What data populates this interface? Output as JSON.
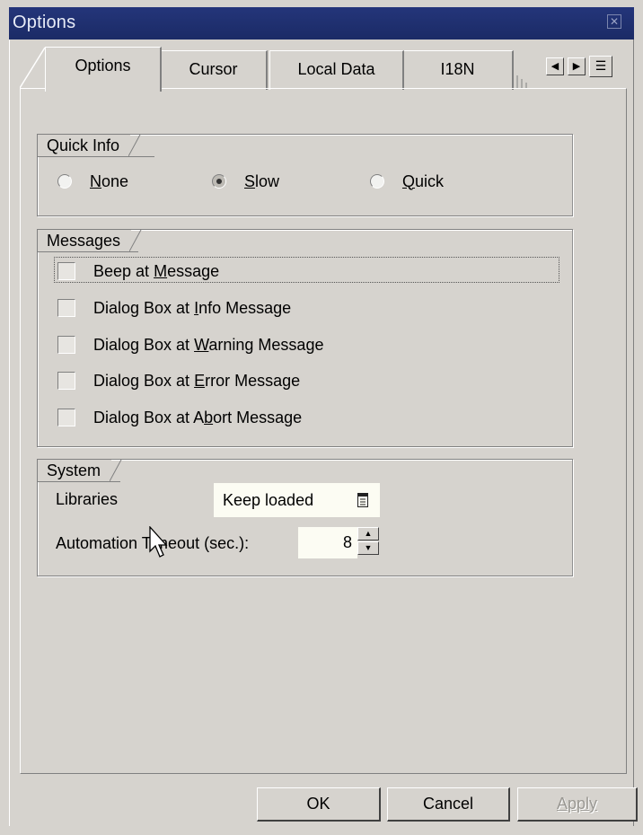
{
  "window": {
    "title": "Options"
  },
  "tabs": [
    {
      "label": "Options",
      "active": true
    },
    {
      "label": "Cursor",
      "active": false
    },
    {
      "label": "Local Data",
      "active": false
    },
    {
      "label": "I18N",
      "active": false
    }
  ],
  "quick_info": {
    "group_label": "Quick Info",
    "options": [
      {
        "prefix": "",
        "accel": "N",
        "rest": "one",
        "selected": false
      },
      {
        "prefix": "",
        "accel": "S",
        "rest": "low",
        "selected": true
      },
      {
        "prefix": "",
        "accel": "Q",
        "rest": "uick",
        "selected": false
      }
    ]
  },
  "messages": {
    "group_label": "Messages",
    "items": [
      {
        "prefix": "Beep at ",
        "accel": "M",
        "rest": "essage",
        "checked": false
      },
      {
        "prefix": "Dialog Box at ",
        "accel": "I",
        "rest": "nfo Message",
        "checked": false
      },
      {
        "prefix": "Dialog Box at ",
        "accel": "W",
        "rest": "arning Message",
        "checked": false
      },
      {
        "prefix": "Dialog Box at ",
        "accel": "E",
        "rest": "rror Message",
        "checked": false
      },
      {
        "prefix": "Dialog Box at A",
        "accel": "b",
        "rest": "ort Message",
        "checked": false
      }
    ]
  },
  "system": {
    "group_label": "System",
    "libraries_label": "Libraries",
    "libraries_value": "Keep loaded",
    "timeout_label": "Automation Timeout (sec.):",
    "timeout_value": "8"
  },
  "buttons": {
    "ok": "OK",
    "cancel": "Cancel",
    "apply": "Apply"
  },
  "icons": {
    "close": "close-icon",
    "tab_scroll_left": "arrow-left-icon",
    "tab_scroll_right": "arrow-right-icon",
    "tab_list": "tab-list-icon",
    "dropdown": "dropdown-list-icon",
    "spin_up": "spin-up-icon",
    "spin_down": "spin-down-icon",
    "cursor": "mouse-pointer-icon"
  }
}
